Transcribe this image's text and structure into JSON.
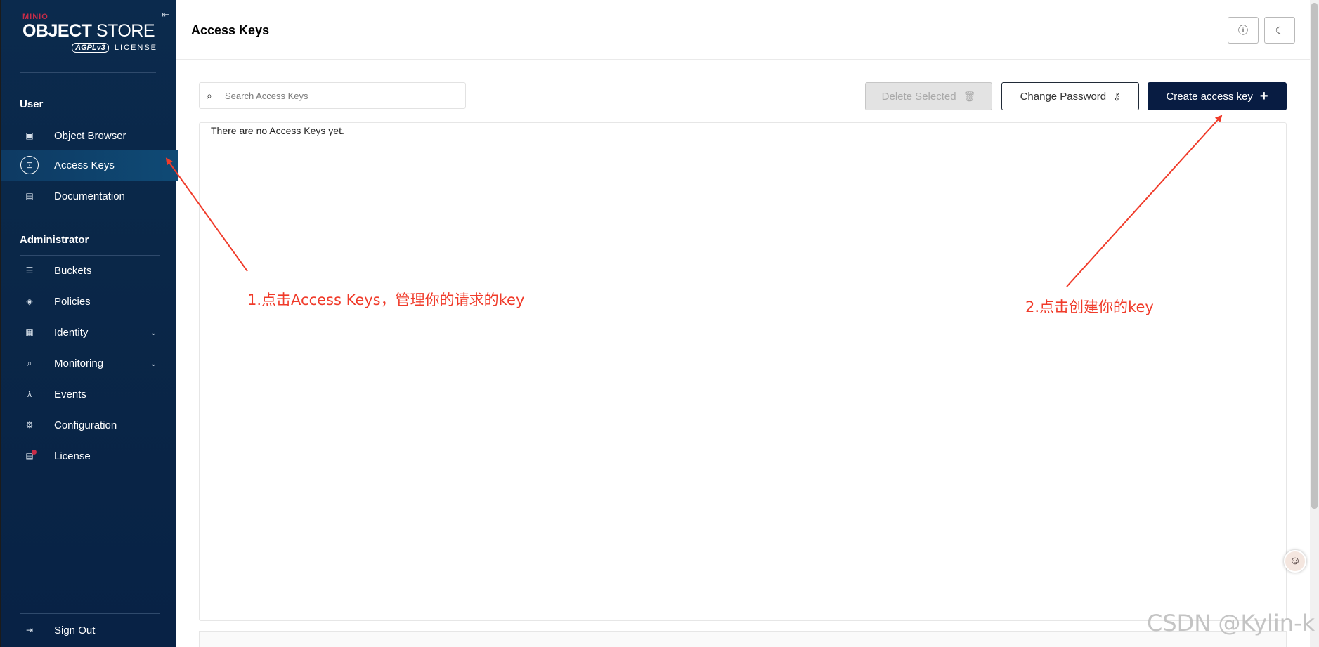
{
  "brand": {
    "vendor": "MINIO",
    "product_bold": "OBJECT",
    "product_rest": " STORE",
    "agpl": "AGPLv3",
    "license": "LICENSE"
  },
  "sidebar": {
    "user_section": "User",
    "user_items": [
      {
        "label": "Object Browser",
        "icon": "object-browser-icon"
      },
      {
        "label": "Access Keys",
        "icon": "access-keys-icon",
        "active": true
      },
      {
        "label": "Documentation",
        "icon": "documentation-icon"
      }
    ],
    "admin_section": "Administrator",
    "admin_items": [
      {
        "label": "Buckets",
        "icon": "buckets-icon"
      },
      {
        "label": "Policies",
        "icon": "policies-icon"
      },
      {
        "label": "Identity",
        "icon": "identity-icon",
        "expandable": true
      },
      {
        "label": "Monitoring",
        "icon": "monitoring-icon",
        "expandable": true
      },
      {
        "label": "Events",
        "icon": "lambda-icon"
      },
      {
        "label": "Configuration",
        "icon": "gear-icon"
      },
      {
        "label": "License",
        "icon": "license-icon"
      }
    ],
    "sign_out": "Sign Out"
  },
  "header": {
    "title": "Access Keys"
  },
  "toolbar": {
    "search_placeholder": "Search Access Keys",
    "delete_label": "Delete Selected",
    "change_password_label": "Change Password",
    "create_label": "Create access key"
  },
  "list": {
    "empty_message": "There are no Access Keys yet."
  },
  "annotations": {
    "step1": "1.点击Access Keys，管理你的请求的key",
    "step2": "2.点击创建你的key"
  },
  "watermark": "CSDN @Kylin-k",
  "colors": {
    "sidebar_bg": "#0b2a4d",
    "primary_button": "#081c42",
    "annotation_red": "#f03b2a",
    "brand_red": "#c72c48"
  }
}
